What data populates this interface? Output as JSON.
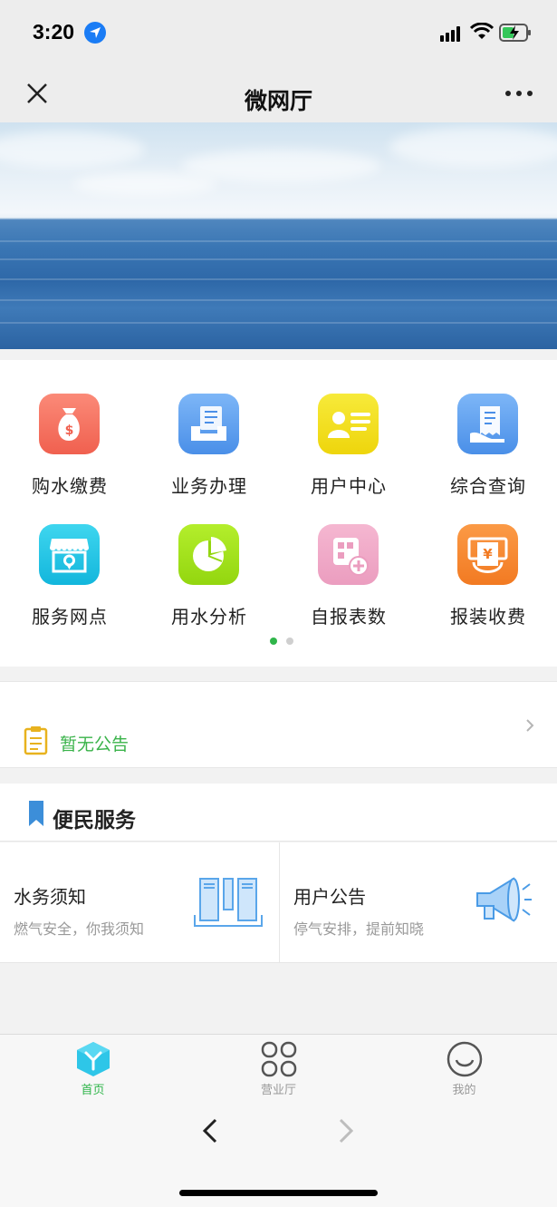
{
  "status_bar": {
    "time": "3:20"
  },
  "nav": {
    "title": "微网厅"
  },
  "grid": {
    "items": [
      {
        "label": "购水缴费",
        "icon": "money-bag-icon",
        "color": "#f26f5d"
      },
      {
        "label": "业务办理",
        "icon": "document-tray-icon",
        "color": "#5a9df0"
      },
      {
        "label": "用户中心",
        "icon": "user-card-icon",
        "color": "#f0dd1f"
      },
      {
        "label": "综合查询",
        "icon": "receipt-icon",
        "color": "#5a9df0"
      },
      {
        "label": "服务网点",
        "icon": "store-icon",
        "color": "#1fc6e6"
      },
      {
        "label": "用水分析",
        "icon": "pie-chart-icon",
        "color": "#a0e01a"
      },
      {
        "label": "自报表数",
        "icon": "meter-add-icon",
        "color": "#f0a8c6"
      },
      {
        "label": "报装收费",
        "icon": "yen-bill-icon",
        "color": "#f78a32"
      }
    ],
    "page_count": 2,
    "active_page": 1
  },
  "notice": {
    "text": "暂无公告"
  },
  "section": {
    "title": "便民服务"
  },
  "services": [
    {
      "title": "水务须知",
      "subtitle": "燃气安全，你我须知",
      "icon": "documents-icon"
    },
    {
      "title": "用户公告",
      "subtitle": "停气安排，提前知晓",
      "icon": "megaphone-icon"
    }
  ],
  "tabs": [
    {
      "label": "首页",
      "icon": "home-cube-icon",
      "active": true
    },
    {
      "label": "营业厅",
      "icon": "grid-apps-icon",
      "active": false
    },
    {
      "label": "我的",
      "icon": "smile-face-icon",
      "active": false
    }
  ],
  "colors": {
    "accent": "#2fb54a",
    "notice": "#3ab34a"
  }
}
